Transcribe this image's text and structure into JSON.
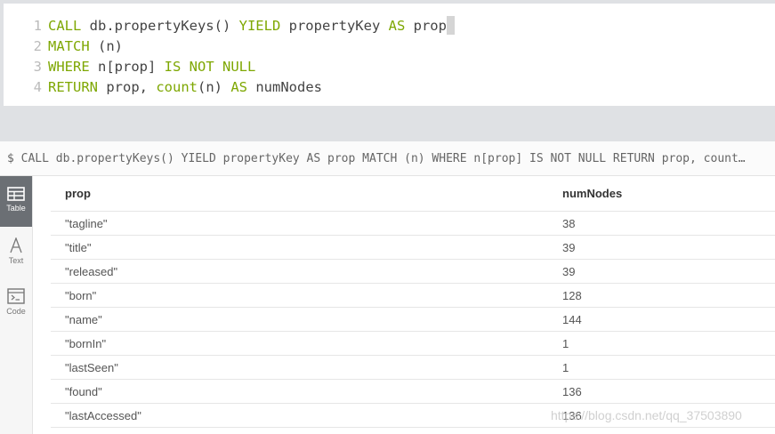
{
  "editor": {
    "lines": [
      {
        "n": "1",
        "parts": [
          [
            "kw",
            "CALL"
          ],
          [
            "tx",
            " db.propertyKeys() "
          ],
          [
            "kw",
            "YIELD"
          ],
          [
            "tx",
            " propertyKey "
          ],
          [
            "kw",
            "AS"
          ],
          [
            "tx",
            " prop"
          ]
        ]
      },
      {
        "n": "2",
        "parts": [
          [
            "kw",
            "MATCH"
          ],
          [
            "tx",
            " (n)"
          ]
        ]
      },
      {
        "n": "3",
        "parts": [
          [
            "kw",
            "WHERE"
          ],
          [
            "tx",
            " n[prop] "
          ],
          [
            "kw",
            "IS NOT NULL"
          ]
        ]
      },
      {
        "n": "4",
        "parts": [
          [
            "kw",
            "RETURN"
          ],
          [
            "tx",
            " prop, "
          ],
          [
            "fn",
            "count"
          ],
          [
            "tx",
            "(n) "
          ],
          [
            "kw",
            "AS"
          ],
          [
            "tx",
            " numNodes"
          ]
        ]
      }
    ]
  },
  "query_bar": {
    "text": "$ CALL db.propertyKeys() YIELD propertyKey AS prop  MATCH (n)  WHERE n[prop] IS NOT NULL  RETURN prop, count…"
  },
  "sidebar": {
    "items": [
      {
        "label": "Table",
        "icon": "table-icon"
      },
      {
        "label": "Text",
        "icon": "text-icon"
      },
      {
        "label": "Code",
        "icon": "code-icon"
      }
    ]
  },
  "table": {
    "headers": [
      "prop",
      "numNodes"
    ],
    "rows": [
      [
        "\"tagline\"",
        "38"
      ],
      [
        "\"title\"",
        "39"
      ],
      [
        "\"released\"",
        "39"
      ],
      [
        "\"born\"",
        "128"
      ],
      [
        "\"name\"",
        "144"
      ],
      [
        "\"bornIn\"",
        "1"
      ],
      [
        "\"lastSeen\"",
        "1"
      ],
      [
        "\"found\"",
        "136"
      ],
      [
        "\"lastAccessed\"",
        "136"
      ]
    ]
  },
  "watermark": "https://blog.csdn.net/qq_37503890"
}
